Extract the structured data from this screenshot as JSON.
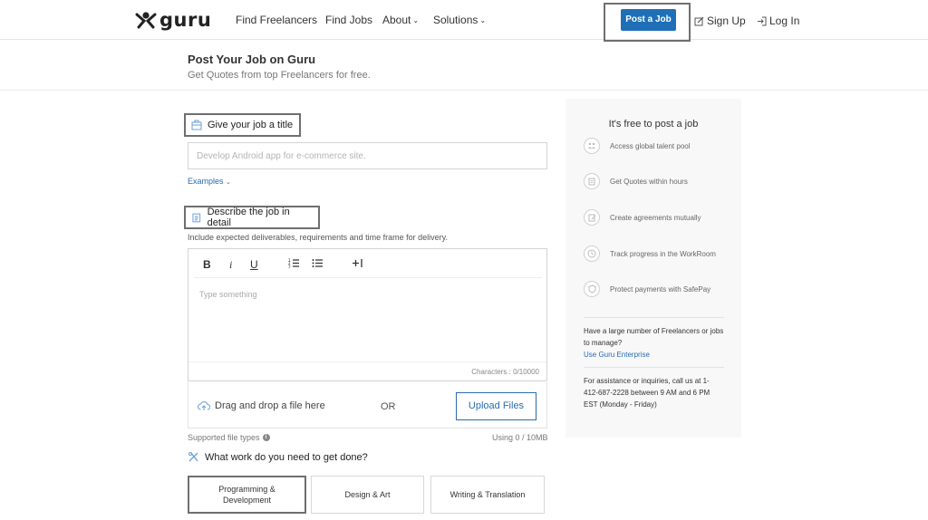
{
  "header": {
    "logo_text": "guru",
    "nav": [
      {
        "label": "Find Freelancers",
        "chevron": false
      },
      {
        "label": "Find Jobs",
        "chevron": false
      },
      {
        "label": "About",
        "chevron": true
      },
      {
        "label": "Solutions",
        "chevron": true
      }
    ],
    "post_job_label": "Post a Job",
    "signup_label": "Sign Up",
    "login_label": "Log In"
  },
  "page": {
    "title": "Post Your Job on Guru",
    "subtitle": "Get Quotes from top Freelancers for free."
  },
  "form": {
    "title_section_label": "Give your job a title",
    "title_placeholder": "Develop Android app for e-commerce site.",
    "examples_label": "Examples",
    "describe_section_label": "Describe the job in detail",
    "describe_hint": "Include expected deliverables, requirements and time frame for delivery.",
    "toolbar": {
      "bold": "B",
      "italic": "i",
      "underline": "U"
    },
    "editor_placeholder": "Type something",
    "char_count": "Characters : 0/10000",
    "drag_drop_text": "Drag and drop a file here",
    "or_text": "OR",
    "upload_label": "Upload Files",
    "supported_label": "Supported file types",
    "usage_label": "Using 0 / 10MB",
    "work_question": "What work do you need to get done?",
    "categories": [
      {
        "label_line1": "Programming &",
        "label_line2": "Development",
        "selected": true
      },
      {
        "label_line1": "Design & Art",
        "label_line2": "",
        "selected": false
      },
      {
        "label_line1": "Writing & Translation",
        "label_line2": "",
        "selected": false
      }
    ]
  },
  "sidebar": {
    "title": "It's free to post a job",
    "items": [
      {
        "label": "Access global talent pool",
        "icon": "people-icon"
      },
      {
        "label": "Get Quotes within hours",
        "icon": "quote-document-icon"
      },
      {
        "label": "Create agreements mutually",
        "icon": "agreement-icon"
      },
      {
        "label": "Track progress in the WorkRoom",
        "icon": "clock-icon"
      },
      {
        "label": "Protect payments with SafePay",
        "icon": "shield-icon"
      }
    ],
    "enterprise_text": "Have a large number of Freelancers or jobs to manage?",
    "enterprise_link": "Use Guru Enterprise",
    "assistance_text": "For assistance or inquiries, call us at 1-412-687-2228 between 9 AM and 6 PM EST (Monday - Friday)"
  },
  "colors": {
    "brand_blue": "#1f6fb8",
    "link_blue": "#2a6bb0",
    "highlight_border": "#6f6f6f"
  }
}
